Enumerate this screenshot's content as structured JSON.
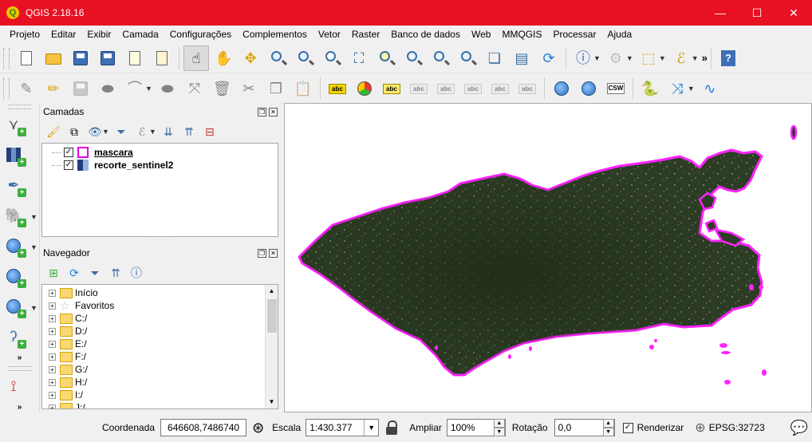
{
  "window": {
    "title": "QGIS 2.18.16",
    "app_icon": "Q",
    "controls": {
      "minimize": "—",
      "maximize": "☐",
      "close": "✕"
    }
  },
  "menu": [
    "Projeto",
    "Editar",
    "Exibir",
    "Camada",
    "Configurações",
    "Complementos",
    "Vetor",
    "Raster",
    "Banco de dados",
    "Web",
    "MMQGIS",
    "Processar",
    "Ajuda"
  ],
  "toolbar1_icons": [
    "new-project-icon",
    "open-project-icon",
    "save-project-icon",
    "save-as-icon",
    "new-print-composer-icon",
    "composer-manager-icon",
    "pan-to-selection-icon",
    "pan-icon",
    "pan-to-center-icon",
    "zoom-in-icon",
    "zoom-out-icon",
    "zoom-native-icon",
    "zoom-full-icon",
    "zoom-to-selection-icon",
    "zoom-to-layer-icon",
    "zoom-last-icon",
    "zoom-next-icon",
    "new-bookmark-icon",
    "show-bookmarks-icon",
    "refresh-icon",
    "identify-icon",
    "select-by-expression-icon",
    "select-features-icon",
    "field-calculator-icon",
    "help-icon"
  ],
  "toolbar1_more": "»",
  "toolbar2": {
    "label_buttons": [
      "abc",
      "abc",
      "abc",
      "abc",
      "abc",
      "abc"
    ],
    "csw_label": "CSW"
  },
  "layers_panel": {
    "title": "Camadas",
    "layers": [
      {
        "name": "mascara",
        "checked": true,
        "type": "polygon"
      },
      {
        "name": "recorte_sentinel2",
        "checked": true,
        "type": "raster"
      }
    ]
  },
  "browser_panel": {
    "title": "Navegador",
    "items": [
      {
        "label": "Início",
        "icon": "folder-icon"
      },
      {
        "label": "Favoritos",
        "icon": "star-icon"
      },
      {
        "label": "C:/",
        "icon": "folder-icon"
      },
      {
        "label": "D:/",
        "icon": "folder-icon"
      },
      {
        "label": "E:/",
        "icon": "folder-icon"
      },
      {
        "label": "F:/",
        "icon": "folder-icon"
      },
      {
        "label": "G:/",
        "icon": "folder-icon"
      },
      {
        "label": "H:/",
        "icon": "folder-icon"
      },
      {
        "label": "I:/",
        "icon": "folder-icon"
      },
      {
        "label": "J:/",
        "icon": "folder-icon"
      }
    ]
  },
  "statusbar": {
    "coord_label": "Coordenada",
    "coord_value": "646608,7486740",
    "scale_label": "Escala",
    "scale_value": "1:430.377",
    "magnify_label": "Ampliar",
    "magnify_value": "100%",
    "rotation_label": "Rotação",
    "rotation_value": "0,0",
    "render_label": "Renderizar",
    "render_checked": true,
    "crs": "EPSG:32723"
  },
  "colors": {
    "titlebar": "#e81123",
    "mask_outline": "#ff22ff",
    "raster_dark": "#2b3a22"
  }
}
